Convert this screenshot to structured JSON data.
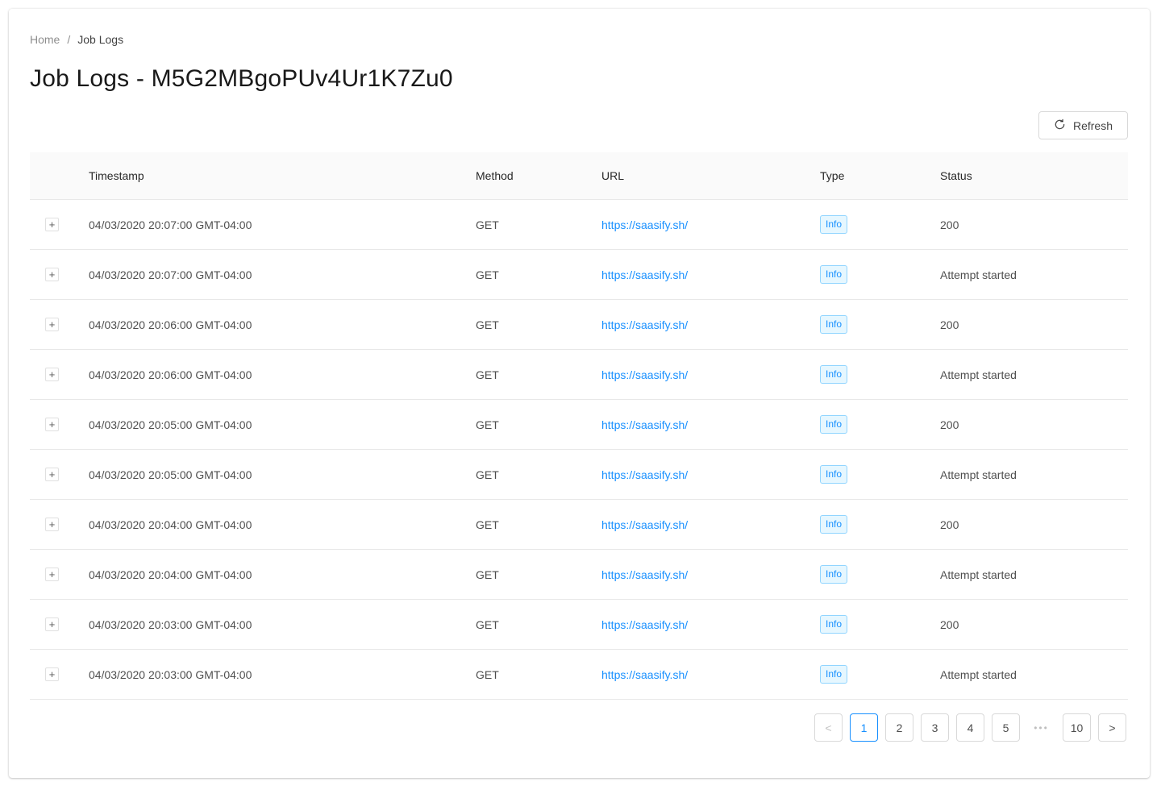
{
  "breadcrumb": {
    "items": [
      "Home",
      "Job Logs"
    ],
    "separator": "/"
  },
  "page_title": "Job Logs - M5G2MBgoPUv4Ur1K7Zu0",
  "toolbar": {
    "refresh_label": "Refresh",
    "refresh_icon": "reload-icon"
  },
  "table": {
    "columns": [
      "",
      "Timestamp",
      "Method",
      "URL",
      "Type",
      "Status"
    ],
    "expand_symbol": "+",
    "rows": [
      {
        "timestamp": "04/03/2020 20:07:00 GMT-04:00",
        "method": "GET",
        "url": "https://saasify.sh/",
        "type": "Info",
        "status": "200"
      },
      {
        "timestamp": "04/03/2020 20:07:00 GMT-04:00",
        "method": "GET",
        "url": "https://saasify.sh/",
        "type": "Info",
        "status": "Attempt started"
      },
      {
        "timestamp": "04/03/2020 20:06:00 GMT-04:00",
        "method": "GET",
        "url": "https://saasify.sh/",
        "type": "Info",
        "status": "200"
      },
      {
        "timestamp": "04/03/2020 20:06:00 GMT-04:00",
        "method": "GET",
        "url": "https://saasify.sh/",
        "type": "Info",
        "status": "Attempt started"
      },
      {
        "timestamp": "04/03/2020 20:05:00 GMT-04:00",
        "method": "GET",
        "url": "https://saasify.sh/",
        "type": "Info",
        "status": "200"
      },
      {
        "timestamp": "04/03/2020 20:05:00 GMT-04:00",
        "method": "GET",
        "url": "https://saasify.sh/",
        "type": "Info",
        "status": "Attempt started"
      },
      {
        "timestamp": "04/03/2020 20:04:00 GMT-04:00",
        "method": "GET",
        "url": "https://saasify.sh/",
        "type": "Info",
        "status": "200"
      },
      {
        "timestamp": "04/03/2020 20:04:00 GMT-04:00",
        "method": "GET",
        "url": "https://saasify.sh/",
        "type": "Info",
        "status": "Attempt started"
      },
      {
        "timestamp": "04/03/2020 20:03:00 GMT-04:00",
        "method": "GET",
        "url": "https://saasify.sh/",
        "type": "Info",
        "status": "200"
      },
      {
        "timestamp": "04/03/2020 20:03:00 GMT-04:00",
        "method": "GET",
        "url": "https://saasify.sh/",
        "type": "Info",
        "status": "Attempt started"
      }
    ]
  },
  "pagination": {
    "prev_symbol": "<",
    "next_symbol": ">",
    "ellipsis": "•••",
    "pages": [
      "1",
      "2",
      "3",
      "4",
      "5"
    ],
    "last_page": "10",
    "current_page": "1"
  },
  "colors": {
    "accent": "#1890ff",
    "tag_bg": "#e6f7ff",
    "tag_border": "#91d5ff"
  }
}
